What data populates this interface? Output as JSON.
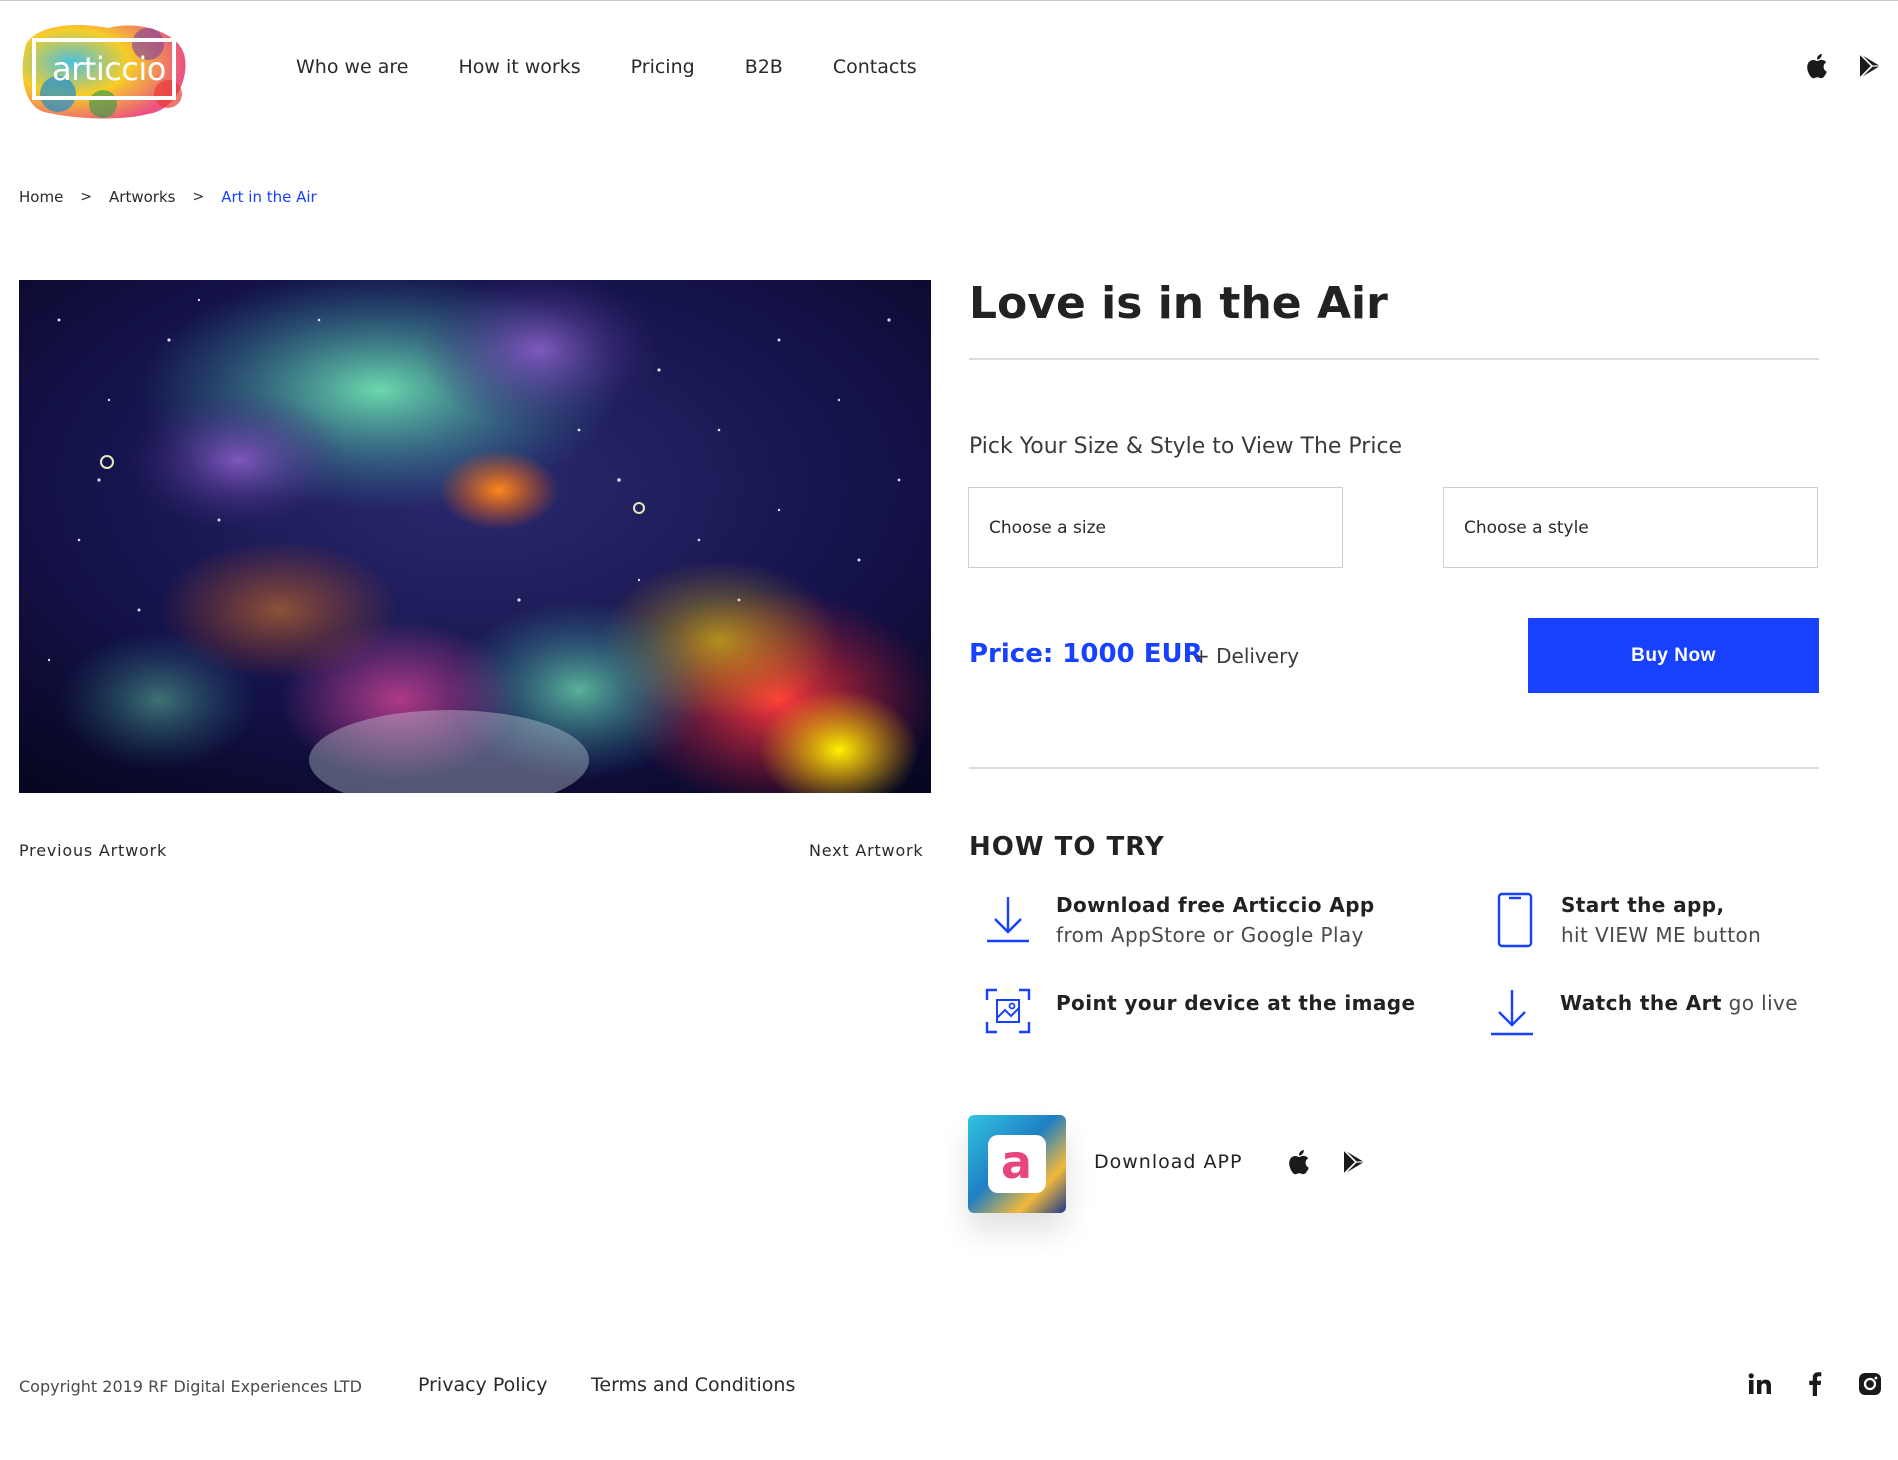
{
  "header": {
    "logo_text": "articcio",
    "nav": [
      "Who we are",
      "How it works",
      "Pricing",
      "B2B",
      "Contacts"
    ],
    "store_icons": [
      "apple-icon",
      "google-play-icon"
    ]
  },
  "breadcrumb": {
    "home": "Home",
    "artworks": "Artworks",
    "current": "Art in the Air",
    "separator": ">"
  },
  "artwork": {
    "previous_label": "Previous Artwork",
    "next_label": "Next Artwork"
  },
  "product": {
    "title": "Love is in the Air",
    "pick_heading": "Pick Your Size & Style to View The Price",
    "size_placeholder": "Choose a size",
    "style_placeholder": "Choose a style",
    "price": "Price: 1000 EUR",
    "delivery": "+ Delivery",
    "buy_label": "Buy Now"
  },
  "how_to_try": {
    "heading": "HOW TO TRY",
    "steps": [
      {
        "icon": "download-arrow-icon",
        "bold": "Download free Articcio App",
        "rest": "from AppStore or Google Play"
      },
      {
        "icon": "phone-icon",
        "bold": "Start the app,",
        "rest": "hit VIEW ME button"
      },
      {
        "icon": "scan-image-icon",
        "bold": "Point your device at the image",
        "rest": ""
      },
      {
        "icon": "download-arrow-icon",
        "bold": "Watch the Art",
        "rest": "go live"
      }
    ]
  },
  "download_app": {
    "label": "Download APP",
    "app_icon_letter": "a"
  },
  "footer": {
    "copyright": "Copyright 2019 RF Digital Experiences LTD",
    "privacy": "Privacy Policy",
    "terms": "Terms and Conditions",
    "social": [
      "linkedin-icon",
      "facebook-icon",
      "instagram-icon"
    ]
  },
  "colors": {
    "accent": "#1740ff",
    "text": "#2a2a2a",
    "divider": "#dcdcdc"
  }
}
